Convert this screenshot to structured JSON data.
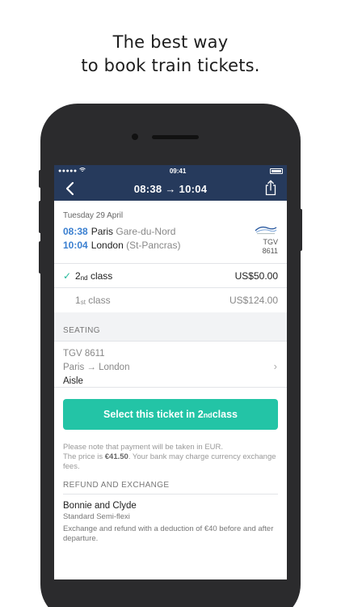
{
  "headline": {
    "line1": "The best way",
    "line2": "to book train tickets."
  },
  "status_bar": {
    "signal": "●●●●● ",
    "time": "09:41"
  },
  "navbar": {
    "title": "08:38 → 10:04"
  },
  "journey": {
    "date": "Tuesday 29 April",
    "departure": {
      "time": "08:38",
      "city": "Paris",
      "station": "Gare-du-Nord"
    },
    "arrival": {
      "time": "10:04",
      "city": "London",
      "station": "(St-Pancras)"
    },
    "operator": {
      "logo": "eurostar-logo",
      "type": "TGV",
      "number": "8611"
    }
  },
  "classes": [
    {
      "ord_num": "2",
      "ord_suffix": "nd",
      "name": "class",
      "price": "US$50.00",
      "selected": true
    },
    {
      "ord_num": "1",
      "ord_suffix": "st",
      "name": "class",
      "price": "US$124.00",
      "selected": false
    }
  ],
  "seating": {
    "section_title": "SEATING",
    "train": "TGV 8611",
    "route": "Paris → London",
    "preference": "Aisle"
  },
  "cta": {
    "prefix": "Select this ticket in 2",
    "suffix_sup": "nd",
    "tail": " class"
  },
  "note": {
    "line1": "Please note that payment will be taken in EUR.",
    "line2_prefix": "The price is ",
    "line2_amount": "€41.50",
    "line2_suffix": ". Your bank may charge currency exchange fees."
  },
  "refund": {
    "section_title": "REFUND AND EXCHANGE",
    "fare_name": "Bonnie and Clyde",
    "fare_type": "Standard Semi-flexi",
    "description": "Exchange and refund with a deduction of €40 before and after departure."
  },
  "colors": {
    "navbar": "#263a5c",
    "accent_blue": "#3a7fd0",
    "cta_green": "#23c4a6",
    "check_green": "#23b99a"
  }
}
